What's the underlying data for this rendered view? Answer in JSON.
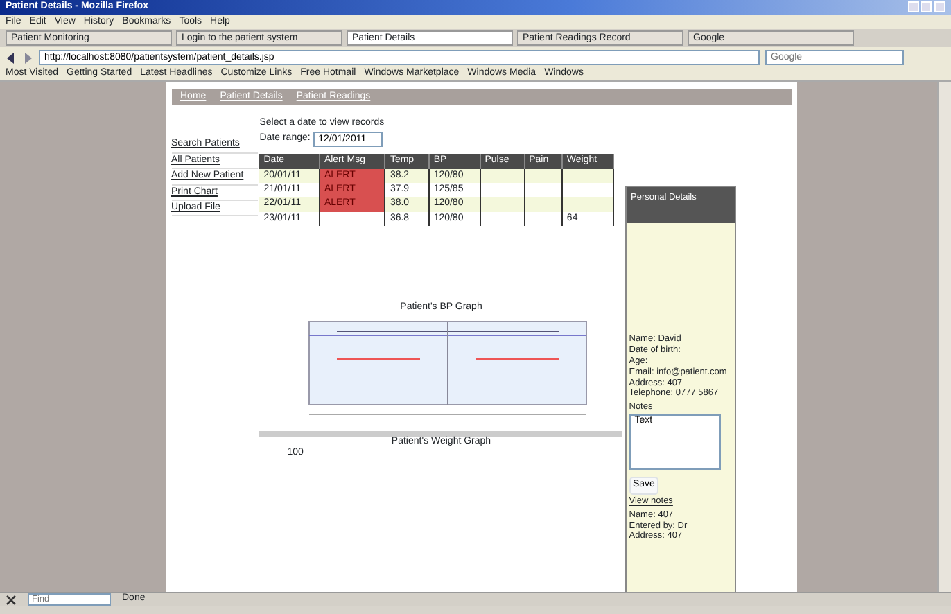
{
  "window": {
    "title": "Patient Details - Mozilla Firefox"
  },
  "menu": [
    "File",
    "Edit",
    "View",
    "History",
    "Bookmarks",
    "Tools",
    "Help"
  ],
  "tabs": [
    {
      "label": "Patient Monitoring",
      "selected": false
    },
    {
      "label": "Login to the patient system",
      "selected": false
    },
    {
      "label": "Patient Details",
      "selected": true
    },
    {
      "label": "Patient Readings Record",
      "selected": false
    },
    {
      "label": "Google",
      "selected": false
    }
  ],
  "address": "http://localhost:8080/patientsystem/patient_details.jsp",
  "search": {
    "placeholder": "Google"
  },
  "bookmarks": [
    "Most Visited",
    "Getting Started",
    "Latest Headlines",
    "Customize Links",
    "Free Hotmail",
    "Windows Marketplace",
    "Windows Media",
    "Windows"
  ],
  "nav": [
    "Home",
    "Patient Details",
    "Patient Readings"
  ],
  "sidebar": [
    {
      "label": "Search Patients"
    },
    {
      "label": "All Patients"
    },
    {
      "label": "Add New Patient"
    },
    {
      "label": "Print Chart"
    },
    {
      "label": "Upload File"
    }
  ],
  "filter": {
    "caption": "Select a date to view records",
    "label": "Date range:",
    "value": "12/01/2011"
  },
  "table": {
    "columns": [
      "Date",
      "Alert Msg",
      "Temp",
      "BP",
      "Pulse",
      "Pain",
      "Weight"
    ],
    "rows": [
      {
        "alert": true,
        "cells": [
          "20/01/11",
          "ALERT",
          "38.2",
          "120/80",
          "",
          "",
          ""
        ]
      },
      {
        "alert": true,
        "cells": [
          "21/01/11",
          "ALERT",
          "37.9",
          "125/85",
          "",
          "",
          ""
        ]
      },
      {
        "alert": true,
        "cells": [
          "22/01/11",
          "ALERT",
          "38.0",
          "120/80",
          "",
          "",
          ""
        ]
      },
      {
        "alert": false,
        "cells": [
          "23/01/11",
          "",
          "36.8",
          "120/80",
          "",
          "",
          "64"
        ]
      }
    ]
  },
  "bp_chart": {
    "title": "Patient's BP Graph"
  },
  "weight_chart": {
    "title": "Patient's Weight Graph",
    "axis_label": "100"
  },
  "details": {
    "title": "Personal Details",
    "lines": [
      "Name: David",
      "Date of birth:",
      "Age:",
      "Email: info@patient.com",
      "Address: 407",
      "Telephone: 0777 5867"
    ],
    "notes_label": "Notes",
    "notes": "Text",
    "save": "Save",
    "view": "View notes",
    "lines2": [
      "Name: 407",
      "Entered by: Dr",
      "Address: 407"
    ]
  },
  "status": {
    "text": "Done",
    "find_placeholder": "Find"
  }
}
